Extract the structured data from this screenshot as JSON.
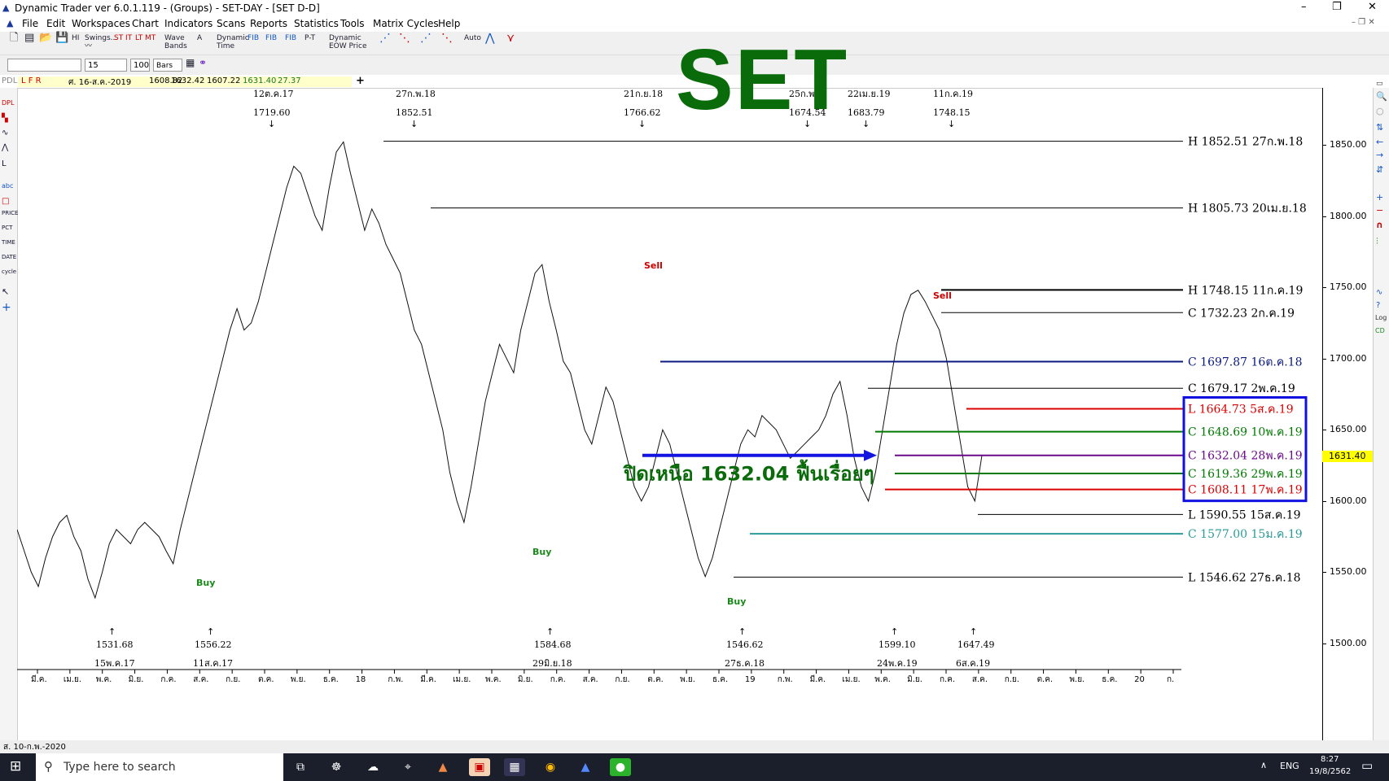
{
  "window": {
    "title": "Dynamic Trader ver 6.0.1.119 - (Groups) - SET-DAY - [SET D-D]",
    "controls": [
      "–",
      "❐",
      "✕"
    ]
  },
  "menu": [
    "File",
    "Edit",
    "Workspaces",
    "Chart",
    "Indicators",
    "Scans",
    "Reports",
    "Statistics",
    "Tools",
    "Matrix Cycles",
    "Help"
  ],
  "toolbar": {
    "swings": "Swings...",
    "st": "ST",
    "it": "IT",
    "lt": "LT",
    "mt": "MT",
    "wave_bands": "Wave Bands",
    "dynamic_time": "Dynamic Time",
    "fib": "FIB",
    "pt": "P-T",
    "dynamic_eow_price": "Dynamic EOW Price",
    "auto": "Auto",
    "period_value": "15",
    "bars_value": "100",
    "bars_unit": "Bars"
  },
  "infobar": {
    "prefix": "L F R",
    "date": "ศ. 16-ส.ค.-2019",
    "open": "1608.82",
    "high": "1632.42",
    "low": "1607.22",
    "close": "1631.40",
    "change": "27.37"
  },
  "overlay_title": "SET",
  "annotation": "ปิดเหนือ 1632.04 ฟื้นเรื่อยๆ",
  "signals": [
    {
      "label": "Sell",
      "color": "#cc0000"
    },
    {
      "label": "Sell",
      "color": "#cc0000"
    },
    {
      "label": "Buy",
      "color": "#1a8a1a"
    },
    {
      "label": "Buy",
      "color": "#1a8a1a"
    },
    {
      "label": "Buy",
      "color": "#1a8a1a"
    }
  ],
  "top_markers": [
    {
      "date": "12ต.ค.17",
      "value": "1719.60"
    },
    {
      "date": "27ก.พ.18",
      "value": "1852.51"
    },
    {
      "date": "21ก.ย.18",
      "value": "1766.62"
    },
    {
      "date": "25ก.พ.",
      "value": "1674.54"
    },
    {
      "date": "22เม.ย.19",
      "value": "1683.79"
    },
    {
      "date": "11ก.ค.19",
      "value": "1748.15"
    }
  ],
  "bottom_markers": [
    {
      "value": "1531.68",
      "date": "15พ.ค.17"
    },
    {
      "value": "1556.22",
      "date": "11ส.ค.17"
    },
    {
      "value": "1584.68",
      "date": "29มิ.ย.18"
    },
    {
      "value": "1546.62",
      "date": "27ธ.ค.18"
    },
    {
      "value": "1599.10",
      "date": "24พ.ค.19"
    },
    {
      "value": "1647.49",
      "date": "6ส.ค.19"
    }
  ],
  "levels": [
    {
      "label": "H 1852.51 27ก.พ.18",
      "price": 1852.51,
      "color": "#000000",
      "text_color": "#000000",
      "boxed": false
    },
    {
      "label": "H 1805.73 20เม.ย.18",
      "price": 1805.73,
      "color": "#000000",
      "text_color": "#000000",
      "boxed": false
    },
    {
      "label": "H 1748.15 11ก.ค.19",
      "price": 1748.15,
      "color": "#000000",
      "text_color": "#000000",
      "boxed": false
    },
    {
      "label": "C 1732.23 2ก.ค.19",
      "price": 1732.23,
      "color": "#000000",
      "text_color": "#000000",
      "boxed": false
    },
    {
      "label": "C 1697.87 16ต.ค.18",
      "price": 1697.87,
      "color": "#0a1a80",
      "text_color": "#0a1a80",
      "boxed": false
    },
    {
      "label": "C 1679.17 2พ.ค.19",
      "price": 1679.17,
      "color": "#000000",
      "text_color": "#000000",
      "boxed": false
    },
    {
      "label": "L 1664.73 5ส.ค.19",
      "price": 1664.73,
      "color": "#dd0000",
      "text_color": "#dd0000",
      "boxed": true
    },
    {
      "label": "C 1648.69 10พ.ค.19",
      "price": 1648.69,
      "color": "#007a00",
      "text_color": "#007a00",
      "boxed": true
    },
    {
      "label": "C 1632.04 28พ.ค.19",
      "price": 1632.04,
      "color": "#6a0a8a",
      "text_color": "#6a0a8a",
      "boxed": true
    },
    {
      "label": "C 1619.36 29พ.ค.19",
      "price": 1619.36,
      "color": "#007a00",
      "text_color": "#007a00",
      "boxed": true
    },
    {
      "label": "C 1608.11 17พ.ค.19",
      "price": 1608.11,
      "color": "#dd0000",
      "text_color": "#dd0000",
      "boxed": true
    },
    {
      "label": "L 1590.55 15ส.ค.19",
      "price": 1590.55,
      "color": "#000000",
      "text_color": "#000000",
      "boxed": false
    },
    {
      "label": "C 1577.00 15ม.ค.19",
      "price": 1577.0,
      "color": "#2a9a9a",
      "text_color": "#2a9a9a",
      "boxed": false
    },
    {
      "label": "L 1546.62 27ธ.ค.18",
      "price": 1546.62,
      "color": "#000000",
      "text_color": "#000000",
      "boxed": false
    }
  ],
  "y_axis": {
    "ticks": [
      "1850.00",
      "1800.00",
      "1750.00",
      "1700.00",
      "1650.00",
      "1600.00",
      "1550.00",
      "1500.00"
    ],
    "range": [
      1480,
      1890
    ],
    "current_price": "1631.40"
  },
  "x_axis": {
    "labels": [
      "มี.ค.",
      "เม.ย.",
      "พ.ค.",
      "มิ.ย.",
      "ก.ค.",
      "ส.ค.",
      "ก.ย.",
      "ต.ค.",
      "พ.ย.",
      "ธ.ค.",
      "18",
      "ก.พ.",
      "มี.ค.",
      "เม.ย.",
      "พ.ค.",
      "มิ.ย.",
      "ก.ค.",
      "ส.ค.",
      "ก.ย.",
      "ต.ค.",
      "พ.ย.",
      "ธ.ค.",
      "19",
      "ก.พ.",
      "มี.ค.",
      "เม.ย.",
      "พ.ค.",
      "มิ.ย.",
      "ก.ค.",
      "ส.ค.",
      "ก.ย.",
      "ต.ค.",
      "พ.ย.",
      "ธ.ค.",
      "20",
      "ก."
    ]
  },
  "statusbar": "ส. 10-ก.พ.-2020",
  "taskbar": {
    "search_placeholder": "Type here to search",
    "lang": "ENG",
    "time": "8:27",
    "date": "19/8/2562"
  },
  "chart_data": {
    "type": "line",
    "series": [
      {
        "values": [
          1580,
          1565,
          1550,
          1540,
          1560,
          1575,
          1585,
          1590,
          1575,
          1565,
          1545,
          1532,
          1550,
          1570,
          1580,
          1575,
          1570,
          1580,
          1585,
          1580,
          1575,
          1565,
          1556,
          1580,
          1600,
          1620,
          1640,
          1660,
          1680,
          1700,
          1720,
          1735,
          1720,
          1725,
          1740,
          1760,
          1780,
          1800,
          1820,
          1835,
          1830,
          1815,
          1800,
          1790,
          1820,
          1845,
          1852,
          1830,
          1810,
          1790,
          1805,
          1795,
          1780,
          1770,
          1760,
          1740,
          1720,
          1710,
          1690,
          1670,
          1650,
          1620,
          1600,
          1585,
          1610,
          1640,
          1670,
          1690,
          1710,
          1700,
          1690,
          1720,
          1740,
          1760,
          1766,
          1740,
          1720,
          1698,
          1690,
          1670,
          1650,
          1640,
          1660,
          1680,
          1670,
          1650,
          1630,
          1610,
          1600,
          1610,
          1630,
          1650,
          1640,
          1620,
          1600,
          1580,
          1560,
          1547,
          1560,
          1580,
          1600,
          1620,
          1640,
          1650,
          1645,
          1660,
          1655,
          1650,
          1640,
          1630,
          1635,
          1640,
          1645,
          1650,
          1660,
          1675,
          1684,
          1660,
          1630,
          1610,
          1600,
          1620,
          1650,
          1680,
          1710,
          1732,
          1745,
          1748,
          1740,
          1730,
          1720,
          1700,
          1670,
          1640,
          1610,
          1600,
          1632
        ]
      }
    ],
    "ylim": [
      1480,
      1890
    ]
  }
}
